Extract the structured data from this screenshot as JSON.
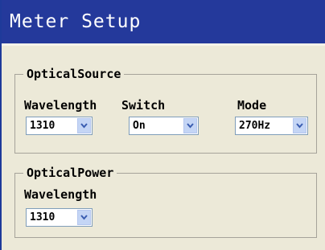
{
  "window": {
    "title": "Meter Setup"
  },
  "optical_source": {
    "group_label": "OpticalSource",
    "wavelength": {
      "label": "Wavelength",
      "value": "1310"
    },
    "switch": {
      "label": "Switch",
      "value": "On"
    },
    "mode": {
      "label": "Mode",
      "value": "270Hz"
    }
  },
  "optical_power": {
    "group_label": "OpticalPower",
    "wavelength": {
      "label": "Wavelength",
      "value": "1310"
    }
  },
  "icons": {
    "dropdown": "chevron-down-icon"
  },
  "colors": {
    "title_bar": "#24399b",
    "panel": "#ece9d8",
    "dropdown_button": "#c4d5f5"
  }
}
